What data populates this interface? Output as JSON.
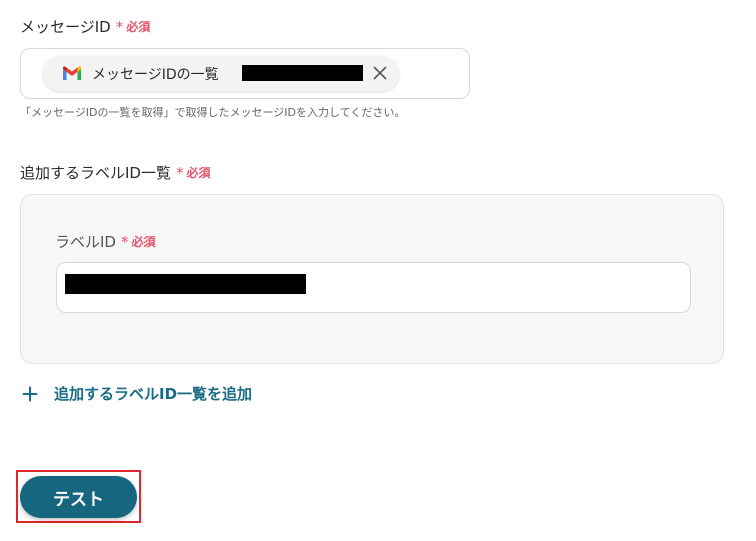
{
  "message_id_field": {
    "label": "メッセージID",
    "required_mark": "*",
    "required_text": "必須",
    "chip_text": "メッセージIDの一覧",
    "help_text": "「メッセージIDの一覧を取得」で取得したメッセージIDを入力してください。"
  },
  "label_ids_section": {
    "label": "追加するラベルID一覧",
    "required_mark": "*",
    "required_text": "必須",
    "inner_label": "ラベルID",
    "inner_required_mark": "*",
    "inner_required_text": "必須"
  },
  "add_link": {
    "label": "追加するラベルID一覧を追加"
  },
  "test_button": {
    "label": "テスト"
  },
  "colors": {
    "required": "#e2546b",
    "accent": "#17667f",
    "link": "#1a6b84",
    "highlight_frame": "#e0262b"
  },
  "icons": [
    "gmail-icon",
    "close-icon",
    "plus-icon"
  ]
}
